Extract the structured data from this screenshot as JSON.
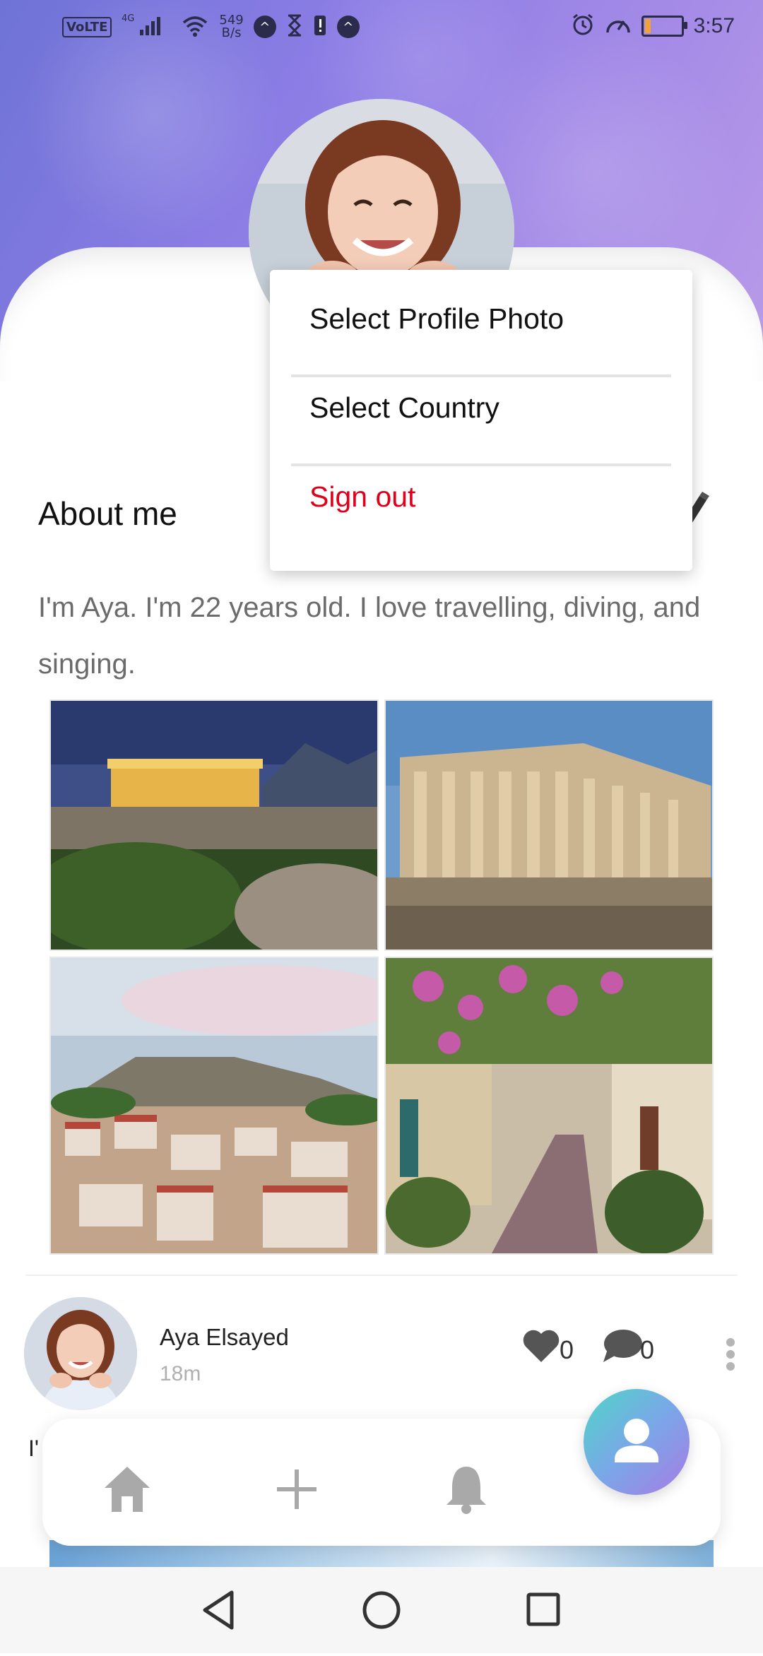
{
  "status_bar": {
    "network": "VoLTE",
    "signal": "4G",
    "data_rate_value": "549",
    "data_rate_unit": "B/s",
    "time": "3:57"
  },
  "profile": {
    "name": "Aya Elsayed"
  },
  "menu": {
    "items": [
      {
        "label": "Select Profile Photo"
      },
      {
        "label": "Select Country"
      },
      {
        "label": "Sign out",
        "color": "#e0001b"
      }
    ]
  },
  "about": {
    "title": "About me",
    "text": "I'm Aya. I'm 22 years old. I love travelling, diving, and singing."
  },
  "post": {
    "author": "Aya Elsayed",
    "time": "18m",
    "likes": "0",
    "comments": "0",
    "text_preview": "I'"
  },
  "bottom_nav": {
    "items": [
      "home-icon",
      "plus-icon",
      "bell-icon",
      "user-icon"
    ],
    "active": "user-icon"
  },
  "colors": {
    "accent_gradient_start": "#4fd6c7",
    "accent_gradient_end": "#a77be4",
    "sign_out": "#e0001b",
    "icon_grey": "#a9a9a9"
  }
}
